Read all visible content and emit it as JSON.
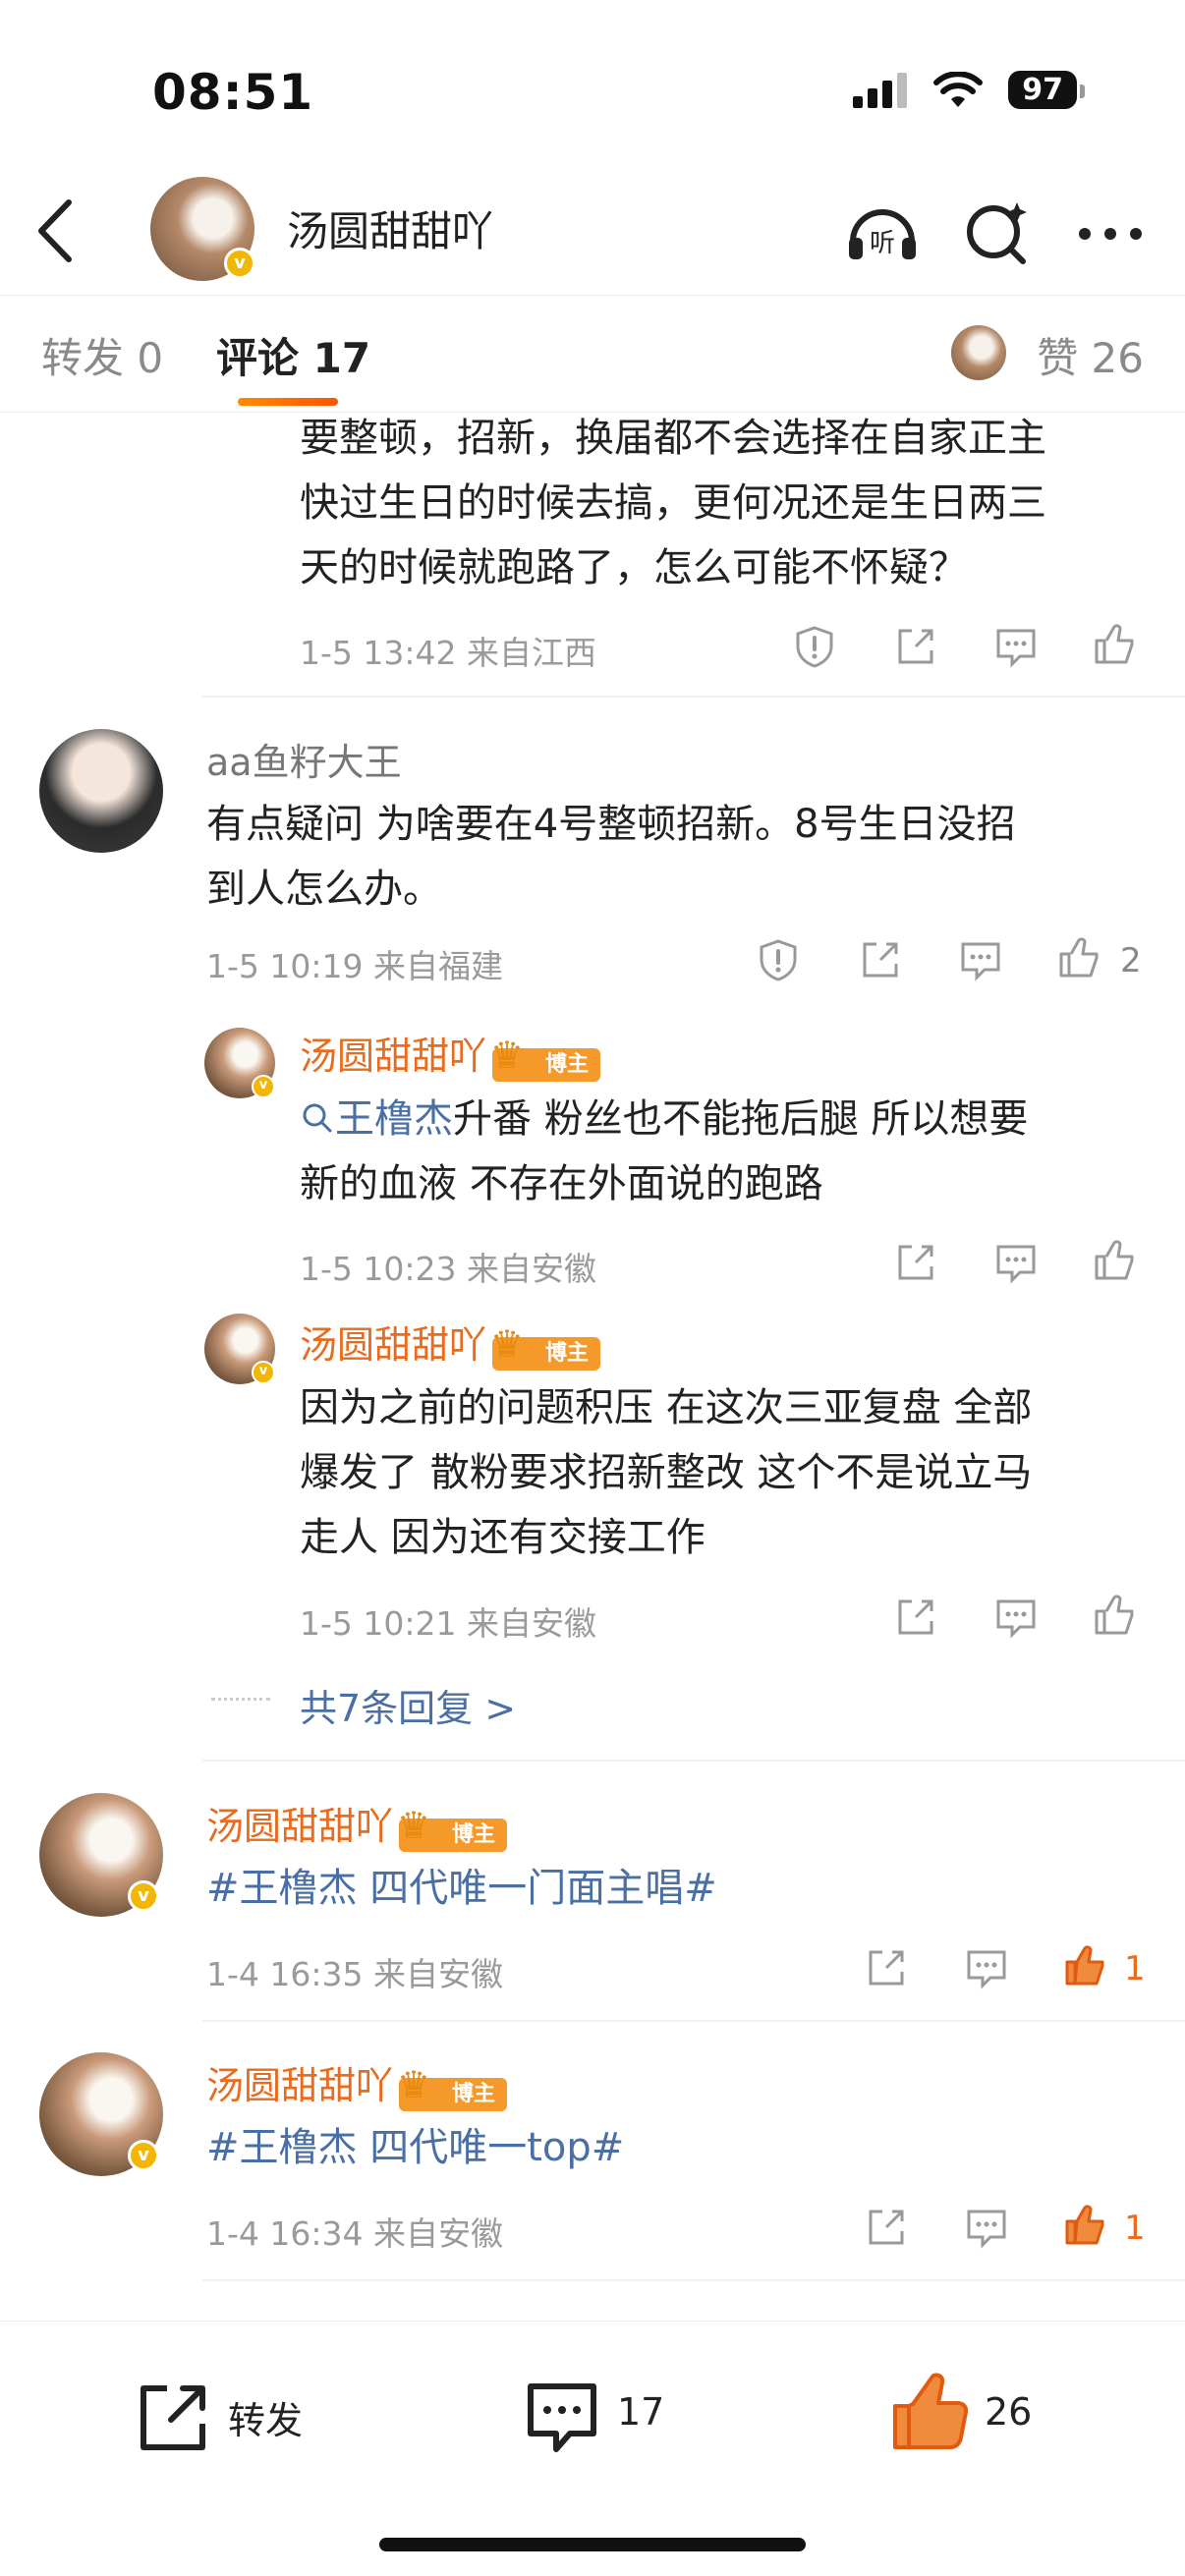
{
  "status_bar": {
    "time": "08:51",
    "battery": "97"
  },
  "nav": {
    "title": "汤圆甜甜吖"
  },
  "tabs": {
    "repost": "转发 0",
    "comment": "评论 17",
    "like": "赞 26"
  },
  "comments": [
    {
      "partial_text": "要整顿，招新，换届都不会选择在自家正主快过生日的时候去搞，更何况还是生日两三天的时候就跑路了，怎么可能不怀疑？",
      "lines": [
        "要整顿，招新，换届都不会选择在自家正主",
        "快过生日的时候去搞，更何况还是生日两三",
        "天的时候就跑路了，怎么可能不怀疑？"
      ],
      "meta": "1-5 13:42 来自江西"
    },
    {
      "user": "aa鱼籽大王",
      "lines": [
        "有点疑问 为啥要在4号整顿招新。8号生日没招",
        "到人怎么办。"
      ],
      "meta": "1-5 10:19 来自福建",
      "likes": "2",
      "replies": [
        {
          "user": "汤圆甜甜吖",
          "badge": "博主",
          "link": "王橹杰",
          "lines": [
            "升番 粉丝也不能拖后腿 所以想要",
            "新的血液 不存在外面说的跑路"
          ],
          "meta": "1-5 10:23 来自安徽"
        },
        {
          "user": "汤圆甜甜吖",
          "badge": "博主",
          "lines": [
            "因为之前的问题积压 在这次三亚复盘 全部",
            "爆发了 散粉要求招新整改 这个不是说立马",
            "走人 因为还有交接工作"
          ],
          "meta": "1-5 10:21 来自安徽"
        }
      ],
      "more_replies": "共7条回复 >"
    },
    {
      "user": "汤圆甜甜吖",
      "badge": "博主",
      "text": "#王橹杰 四代唯一门面主唱#",
      "meta": "1-4 16:35 来自安徽",
      "likes": "1"
    },
    {
      "user": "汤圆甜甜吖",
      "badge": "博主",
      "text": "#王橹杰 四代唯一top#",
      "meta": "1-4 16:34 来自安徽",
      "likes": "1"
    }
  ],
  "bottom_bar": {
    "repost": "转发",
    "comments": "17",
    "likes": "26"
  },
  "colors": {
    "accent": "#e86b1e",
    "link": "#4a6fa5",
    "meta": "#9a9a9a"
  }
}
